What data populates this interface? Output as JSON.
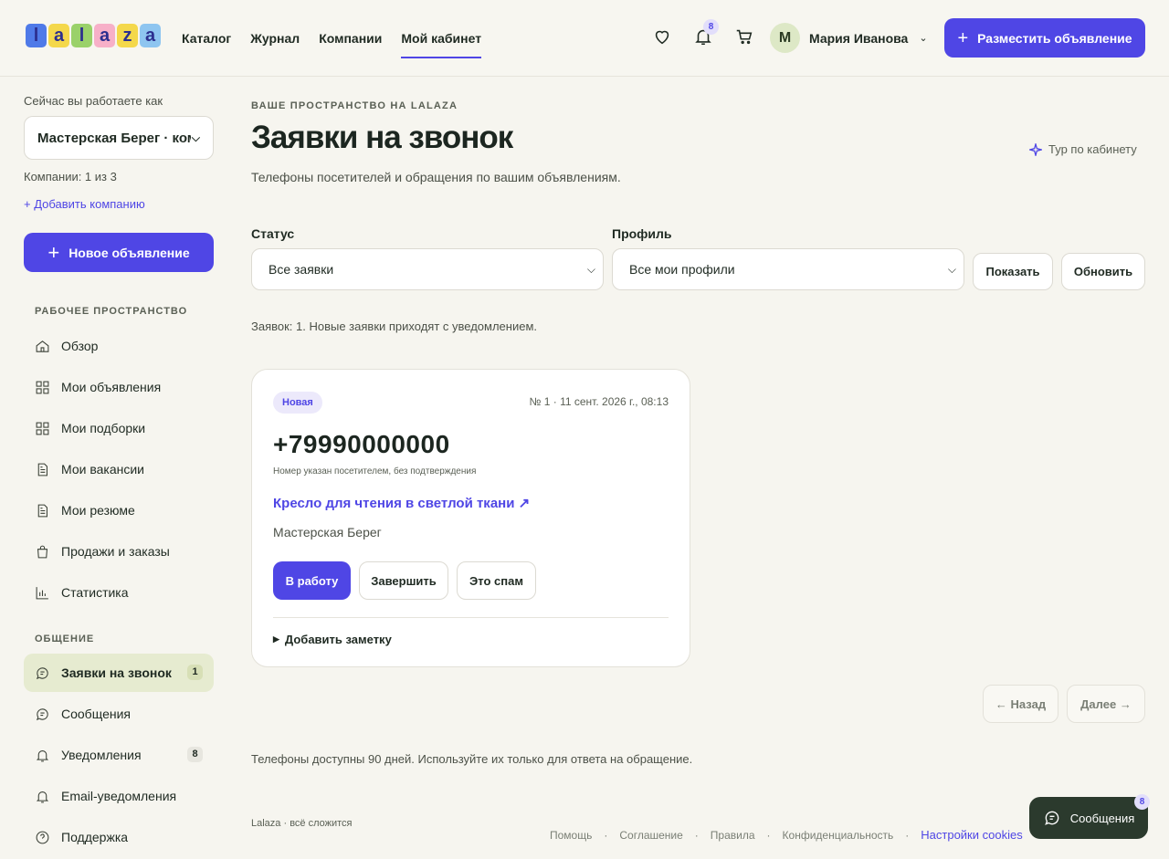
{
  "brand": {
    "logo_letters": [
      "l",
      "a",
      "l",
      "a",
      "z",
      "a"
    ],
    "logo_colors": [
      "#4f7ae8",
      "#f4d84b",
      "#9ad16a",
      "#f7b0c8",
      "#f4d84b",
      "#8ec5f0"
    ],
    "accent": "#4f46e5"
  },
  "nav": {
    "items": [
      "Каталог",
      "Журнал",
      "Компании",
      "Мой кабинет"
    ],
    "active": "Мой кабинет"
  },
  "header": {
    "notifications_count": "8",
    "user_initial": "М",
    "user_name": "Мария Иванова",
    "post_button": "Разместить объявление"
  },
  "sidebar": {
    "working_as": "Сейчас вы работаете как",
    "company_selected": "Мастерская Берег · компания",
    "companies_count": "Компании: 1 из 3",
    "add_company": "+ Добавить компанию",
    "new_ad": "Новое объявление",
    "section_workspace": "РАБОЧЕЕ ПРОСТРАНСТВО",
    "workspace_items": [
      {
        "label": "Обзор",
        "icon": "home-icon"
      },
      {
        "label": "Мои объявления",
        "icon": "grid-icon"
      },
      {
        "label": "Мои подборки",
        "icon": "grid-icon"
      },
      {
        "label": "Мои вакансии",
        "icon": "document-icon"
      },
      {
        "label": "Мои резюме",
        "icon": "document-icon"
      },
      {
        "label": "Продажи и заказы",
        "icon": "bag-icon"
      },
      {
        "label": "Статистика",
        "icon": "chart-icon"
      }
    ],
    "section_comm": "ОБЩЕНИЕ",
    "comm_items": [
      {
        "label": "Заявки на звонок",
        "icon": "chat-icon",
        "badge": "1",
        "active": true
      },
      {
        "label": "Сообщения",
        "icon": "chat-icon"
      },
      {
        "label": "Уведомления",
        "icon": "bell-icon",
        "badge": "8"
      },
      {
        "label": "Email-уведомления",
        "icon": "bell-icon"
      },
      {
        "label": "Поддержка",
        "icon": "help-icon"
      }
    ]
  },
  "main": {
    "eyebrow": "ВАШЕ ПРОСТРАНСТВО НА LALAZA",
    "title": "Заявки на звонок",
    "tour": "Тур по кабинету",
    "subtitle": "Телефоны посетителей и обращения по вашим объявлениям.",
    "filters": {
      "status_label": "Статус",
      "status_value": "Все заявки",
      "profile_label": "Профиль",
      "profile_value": "Все мои профили",
      "show_button": "Показать",
      "refresh_button": "Обновить"
    },
    "count_line": "Заявок: 1. Новые заявки приходят с уведомлением.",
    "request": {
      "status": "Новая",
      "meta": "№ 1 · 11 сент. 2026 г., 08:13",
      "phone": "+79990000000",
      "phone_note": "Номер указан посетителем, без подтверждения",
      "ad_link": "Кресло для чтения в светлой ткани ↗",
      "company": "Мастерская Берег",
      "btn_work": "В работу",
      "btn_done": "Завершить",
      "btn_spam": "Это спам",
      "add_note": "Добавить заметку"
    },
    "pagination": {
      "prev": "← Назад",
      "next": "Далее →"
    },
    "footnote": "Телефоны доступны 90 дней. Используйте их только для ответа на обращение."
  },
  "footer": {
    "copyright": "Lalaza · всё сложится",
    "links": [
      "Помощь",
      "Соглашение",
      "Правила",
      "Конфиденциальность"
    ],
    "cookies": "Настройки cookies"
  },
  "chat_fab": {
    "label": "Сообщения",
    "badge": "8"
  }
}
